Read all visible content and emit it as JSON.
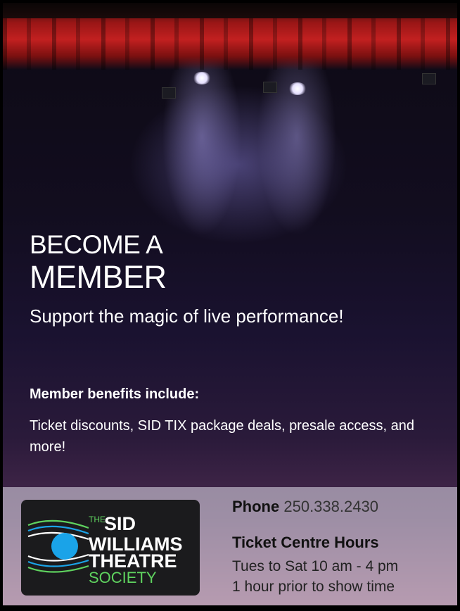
{
  "hero": {
    "headline_line1": "BECOME A",
    "headline_line2": "MEMBER",
    "tagline": "Support the magic of live performance!"
  },
  "benefits": {
    "title": "Member benefits include:",
    "text": "Ticket discounts, SID TIX package deals, presale access, and more!"
  },
  "logo": {
    "the": "THE",
    "line1": "SID",
    "line2": "WILLIAMS",
    "line3": "THEATRE",
    "line4": "SOCIETY"
  },
  "contact": {
    "phone_label": "Phone",
    "phone_number": "250.338.2430",
    "hours_title": "Ticket Centre Hours",
    "hours_line1": "Tues to Sat 10 am - 4 pm",
    "hours_line2": "1 hour prior to show time"
  },
  "colors": {
    "logo_accent_green": "#5fd35f",
    "logo_circle_blue": "#1aa3e8",
    "curtain_red": "#c22020"
  }
}
